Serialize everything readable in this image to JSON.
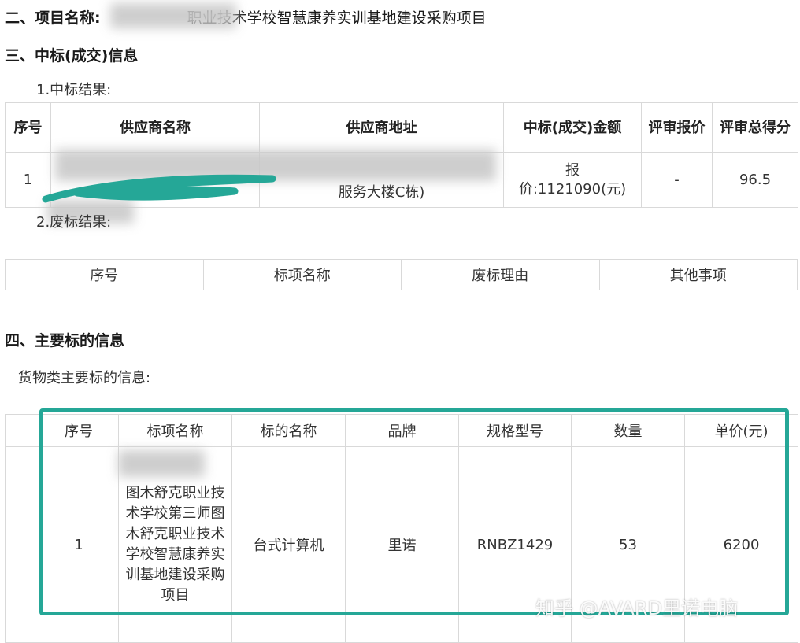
{
  "section2": {
    "label": "二、项目名称:",
    "value": "职业技术学校智慧康养实训基地建设采购项目"
  },
  "section3": {
    "title": "三、中标(成交)信息",
    "result_label": "1.中标结果:",
    "headers": [
      "序号",
      "供应商名称",
      "供应商地址",
      "中标(成交)金额",
      "评审报价",
      "评审总得分"
    ],
    "row": {
      "no": "1",
      "address_tail": "服务大楼C栋)",
      "amount": "报价:1121090(元)",
      "review_price": "-",
      "score": "96.5"
    },
    "fail_label": "2.废标结果:",
    "fail_headers": [
      "序号",
      "标项名称",
      "废标理由",
      "其他事项"
    ]
  },
  "section4": {
    "title": "四、主要标的信息",
    "subtitle": "货物类主要标的信息:",
    "headers": [
      "序号",
      "标项名称",
      "标的名称",
      "品牌",
      "规格型号",
      "数量",
      "单价(元)"
    ],
    "row": {
      "no": "1",
      "item_name": "图木舒克职业技术学校第三师图木舒克职业技术学校智慧康养实训基地建设采购项目",
      "subject": "台式计算机",
      "brand": "里诺",
      "model": "RNBZ1429",
      "qty": "53",
      "price": "6200"
    }
  },
  "watermark": "知乎 @AVARD里诺电脑",
  "colors": {
    "highlight": "#25a797",
    "border": "#d9d9d9"
  }
}
